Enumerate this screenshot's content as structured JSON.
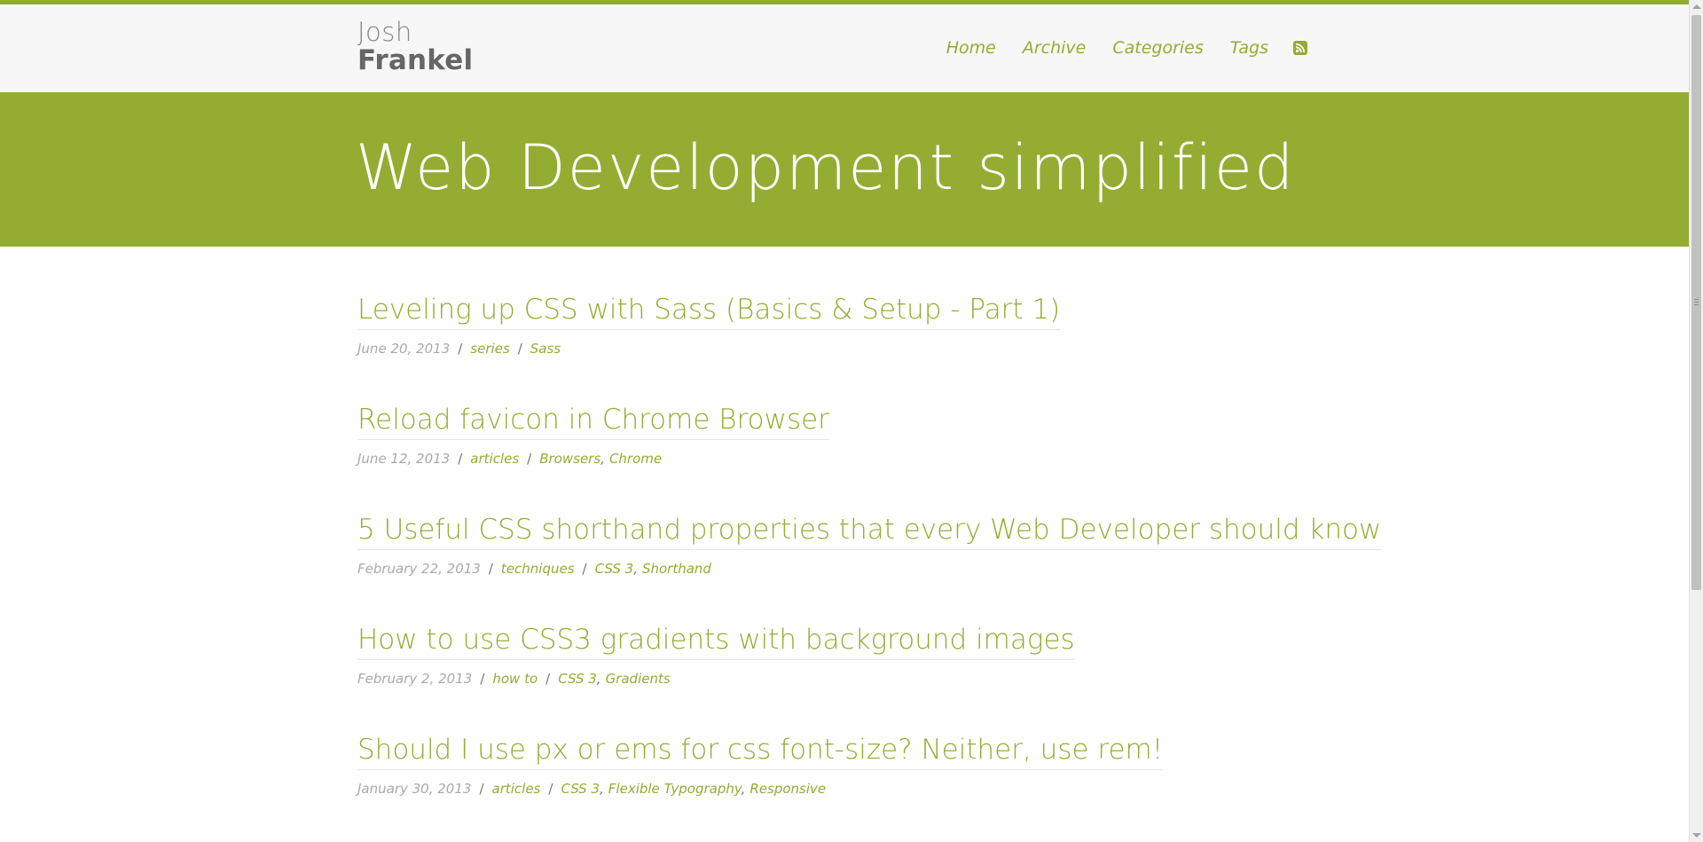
{
  "brand": {
    "first": "Josh",
    "last": "Frankel"
  },
  "nav": {
    "items": [
      "Home",
      "Archive",
      "Categories",
      "Tags"
    ],
    "rss_icon": "rss-icon"
  },
  "hero": {
    "title": "Web Development simplified"
  },
  "posts": [
    {
      "title": "Leveling up CSS with Sass (Basics & Setup - Part 1)",
      "date": "June 20, 2013",
      "category": "series",
      "tags": [
        "Sass"
      ]
    },
    {
      "title": "Reload favicon in Chrome Browser",
      "date": "June 12, 2013",
      "category": "articles",
      "tags": [
        "Browsers",
        "Chrome"
      ]
    },
    {
      "title": "5 Useful CSS shorthand properties that every Web Developer should know",
      "date": "February 22, 2013",
      "category": "techniques",
      "tags": [
        "CSS 3",
        "Shorthand"
      ]
    },
    {
      "title": "How to use CSS3 gradients with background images",
      "date": "February 2, 2013",
      "category": "how to",
      "tags": [
        "CSS 3",
        "Gradients"
      ]
    },
    {
      "title": "Should I use px or ems for css font-size? Neither, use rem!",
      "date": "January 30, 2013",
      "category": "articles",
      "tags": [
        "CSS 3",
        "Flexible Typography",
        "Responsive"
      ]
    }
  ],
  "meta": {
    "separator": "/",
    "tag_comma": ","
  },
  "colors": {
    "accent": "#93ad32",
    "masthead_bg": "#f7f7f7",
    "date_text": "#aaaaaa",
    "brand_text": "#666666"
  }
}
